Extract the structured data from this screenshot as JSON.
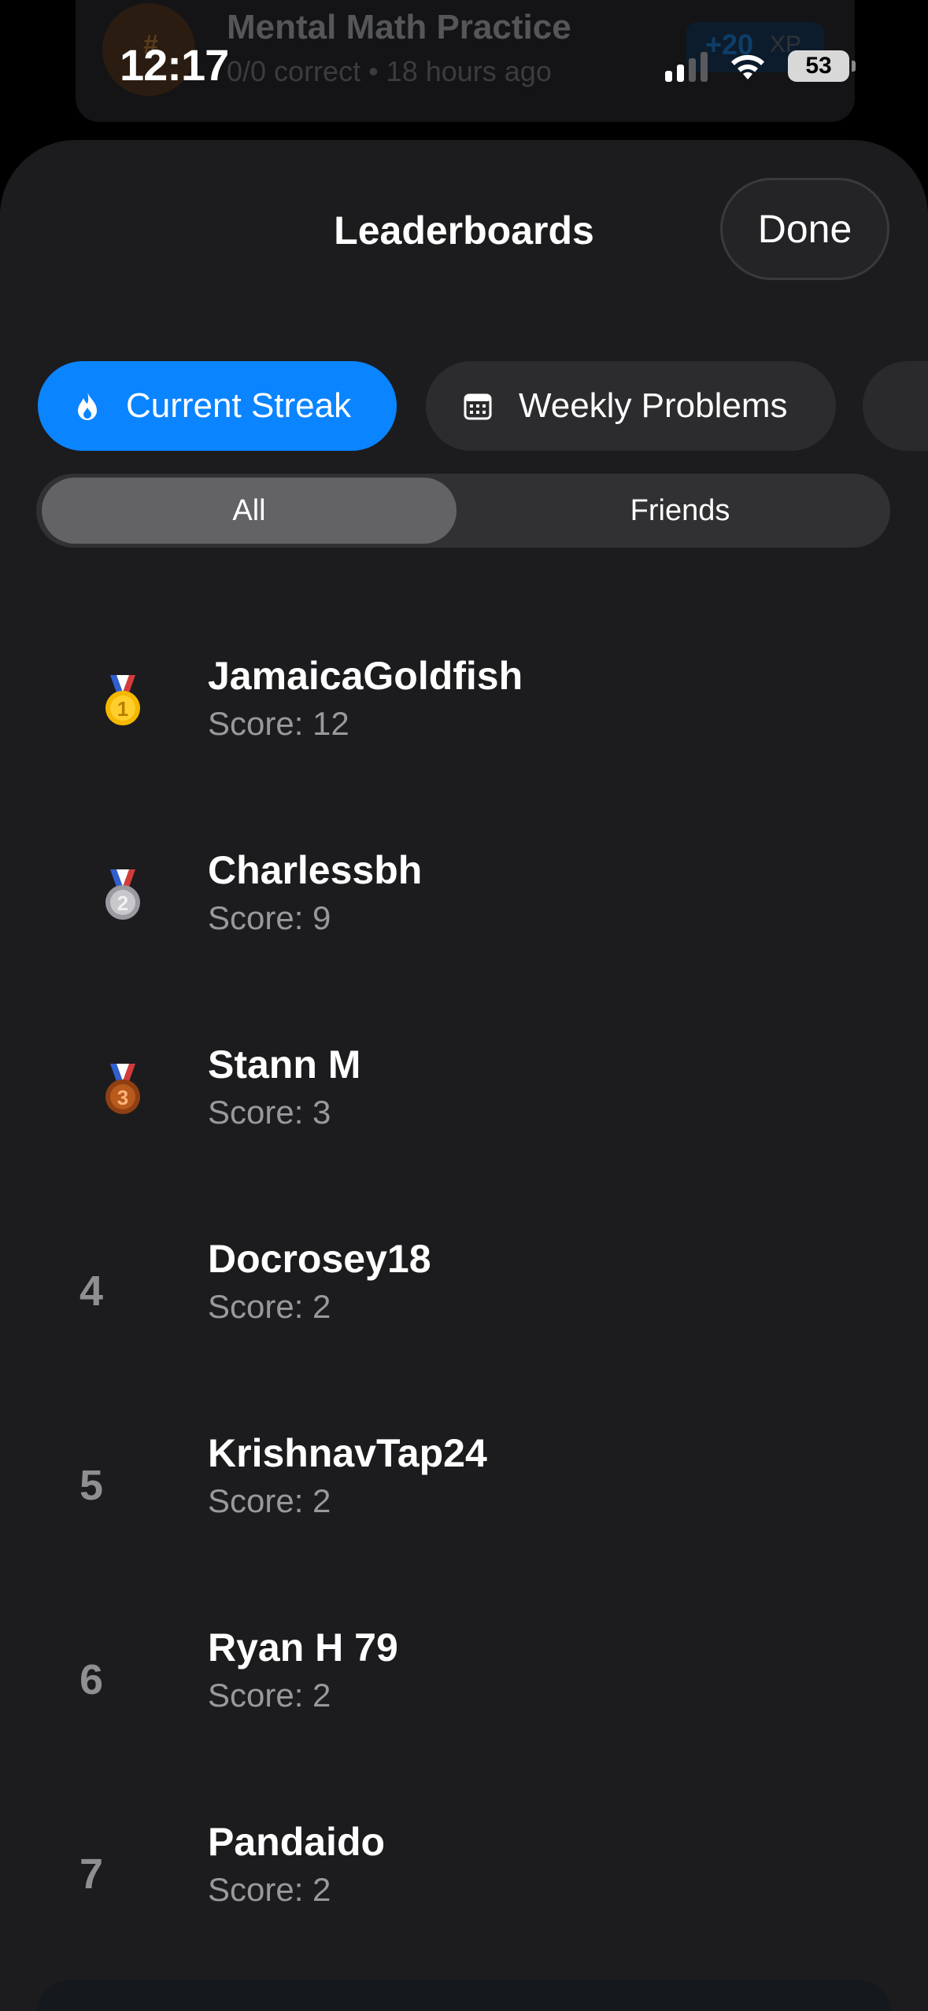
{
  "background_card": {
    "title": "Mental Math Practice",
    "subtitle": "0/0 correct • 18 hours ago",
    "xp_value": "+20",
    "xp_unit": "XP",
    "badge_symbol": "#"
  },
  "status_bar": {
    "time": "12:17",
    "battery": "53",
    "signal_bars": 2
  },
  "header": {
    "title": "Leaderboards",
    "done_label": "Done"
  },
  "categories": [
    {
      "label": "Current Streak",
      "icon": "flame-icon",
      "selected": true
    },
    {
      "label": "Weekly Problems",
      "icon": "calendar-icon",
      "selected": false
    },
    {
      "label": "",
      "icon": "trophy-icon",
      "selected": false
    }
  ],
  "segment": {
    "options": [
      {
        "label": "All",
        "selected": true
      },
      {
        "label": "Friends",
        "selected": false
      }
    ]
  },
  "leaderboard": [
    {
      "rank": "1",
      "medal": "gold",
      "name": "JamaicaGoldfish",
      "score": "Score: 12"
    },
    {
      "rank": "2",
      "medal": "silver",
      "name": "Charlessbh",
      "score": "Score: 9"
    },
    {
      "rank": "3",
      "medal": "bronze",
      "name": "Stann M",
      "score": "Score: 3"
    },
    {
      "rank": "4",
      "medal": "",
      "name": "Docrosey18",
      "score": "Score: 2"
    },
    {
      "rank": "5",
      "medal": "",
      "name": "KrishnavTap24",
      "score": "Score: 2"
    },
    {
      "rank": "6",
      "medal": "",
      "name": "Ryan H 79",
      "score": "Score: 2"
    },
    {
      "rank": "7",
      "medal": "",
      "name": "Pandaido",
      "score": "Score: 2"
    }
  ],
  "colors": {
    "accent": "#0a84ff",
    "sheet_bg": "#1c1c1e",
    "gold": "#f5b800",
    "silver": "#b8b8bd",
    "bronze": "#b85a1c"
  }
}
